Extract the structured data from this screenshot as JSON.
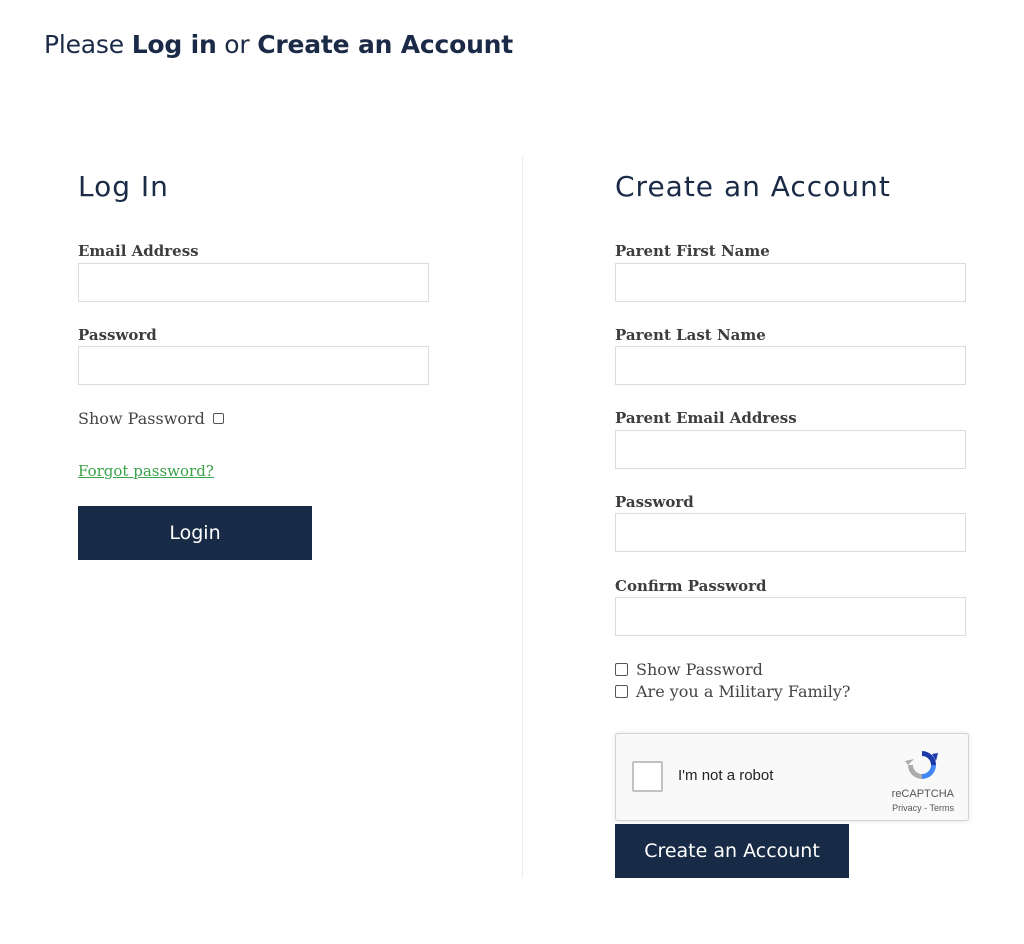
{
  "page": {
    "heading_prefix": "Please ",
    "heading_login": "Log in",
    "heading_or": " or ",
    "heading_create": "Create an Account"
  },
  "login": {
    "title": "Log In",
    "email_label": "Email Address",
    "email_value": "",
    "password_label": "Password",
    "password_value": "",
    "show_password_label": "Show Password",
    "forgot_password": "Forgot password?",
    "login_button": "Login"
  },
  "create": {
    "title": "Create an Account",
    "first_name_label": "Parent First Name",
    "last_name_label": "Parent Last Name",
    "email_label": "Parent Email Address",
    "password_label": "Password",
    "confirm_password_label": "Confirm Password",
    "show_password_label": "Show Password",
    "military_label": "Are you a Military Family?",
    "create_button": "Create an Account"
  },
  "recaptcha": {
    "label": "I'm not a robot",
    "brand": "reCAPTCHA",
    "links": "Privacy - Terms"
  },
  "colors": {
    "primary": "#172b46",
    "link": "#3aa24a",
    "heading": "#1b2a47"
  }
}
